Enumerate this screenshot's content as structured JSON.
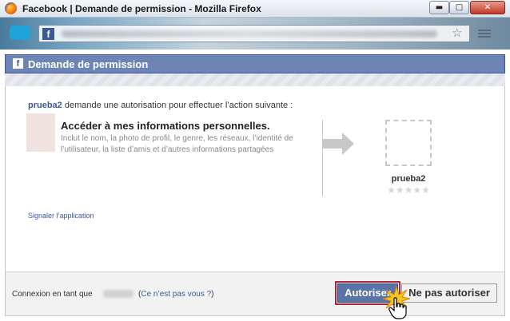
{
  "window": {
    "title": "Facebook | Demande de permission - Mozilla Firefox",
    "minimize_symbol": "▬",
    "maximize_symbol": "□",
    "close_symbol": "✕"
  },
  "addressbar": {
    "favicon_letter": "f",
    "star_icon": "star-icon",
    "menu_icon": "menu-icon"
  },
  "dialog": {
    "header_icon_letter": "f",
    "title": "Demande de permission",
    "request_app": "prueba2",
    "request_text": " demande une autorisation pour effectuer l’action suivante :",
    "permission_title": "Accéder à mes informations personnelles.",
    "permission_desc": "Inclut le nom, la photo de profil, le genre, les réseaux, l’identité de l’utilisateur, la liste d’amis et d’autres informations partagées",
    "app_name": "prueba2",
    "rating": "★★★★★",
    "report_link": "Signaler l’application"
  },
  "footer": {
    "login_label": "Connexion en tant que",
    "not_you_open": "(",
    "not_you_link": "Ce n’est pas vous ?",
    "not_you_close": ")",
    "allow_label": "Autoriser",
    "deny_label": "Ne pas autoriser"
  },
  "colors": {
    "facebook_blue": "#3b5998",
    "header_blue": "#6d84b4",
    "allow_button": "#5b74a8",
    "highlight_outline": "#b0243a"
  }
}
